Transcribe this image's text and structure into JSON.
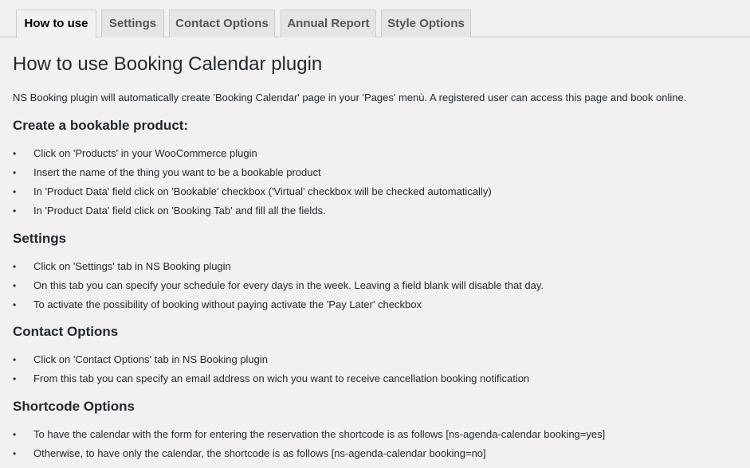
{
  "tabs": [
    {
      "label": "How to use"
    },
    {
      "label": "Settings"
    },
    {
      "label": "Contact Options"
    },
    {
      "label": "Annual Report"
    },
    {
      "label": "Style Options"
    }
  ],
  "page_title": "How to use Booking Calendar plugin",
  "intro": "NS Booking plugin will automatically create 'Booking Calendar' page in your 'Pages' menù. A registered user can access this page and book online.",
  "bullet_glyph": "•",
  "sections": [
    {
      "title": "Create a bookable product:",
      "items": [
        "Click on 'Products' in your WooCommerce plugin",
        "Insert the name of the thing you want to be a bookable product",
        "In 'Product Data' field click on 'Bookable' checkbox ('Virtual' checkbox will be checked automatically)",
        "In 'Product Data' field click on 'Booking Tab' and fill all the fields."
      ]
    },
    {
      "title": "Settings",
      "items": [
        "Click on 'Settings' tab in NS Booking plugin",
        "On this tab you can specify your schedule for every days in the week. Leaving a field blank will disable that day.",
        "To activate the possibility of booking without paying activate the 'Pay Later' checkbox"
      ]
    },
    {
      "title": "Contact Options",
      "items": [
        "Click on 'Contact Options' tab in NS Booking plugin",
        "From this tab you can specify an email address on wich you want to receive cancellation booking notification"
      ]
    },
    {
      "title": "Shortcode Options",
      "items": [
        "To have the calendar with the form for entering the reservation the shortcode is as follows [ns-agenda-calendar booking=yes]",
        "Otherwise, to have only the calendar, the shortcode is as follows [ns-agenda-calendar booking=no]"
      ]
    }
  ]
}
